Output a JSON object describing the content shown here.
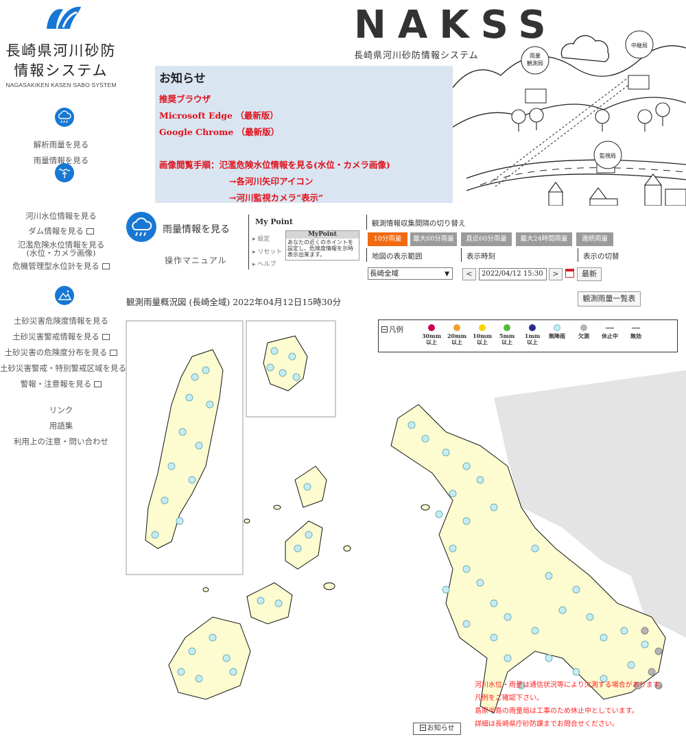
{
  "sidebar": {
    "title": "長崎県河川砂防\n情報システム",
    "subtitle": "NAGASAKIKEN KASEN SABO SYSTEM",
    "rain_links": [
      "解析雨量を見る",
      "雨量情報を見る"
    ],
    "river_links": [
      "河川水位情報を見る",
      "ダム情報を見る",
      "氾濫危険水位情報を見る\n(水位・カメラ画像)",
      "危機管理型水位計を見る"
    ],
    "sabo_links": [
      "土砂災害危険度情報を見る",
      "土砂災害警戒情報を見る",
      "土砂災害の危険度分布を見る",
      "土砂災害警戒・特別警戒区域を見る",
      "警報・注意報を見る"
    ],
    "misc_links": [
      "リンク",
      "用語集",
      "利用上の注意・問い合わせ"
    ]
  },
  "header": {
    "brand": "NAKSS",
    "brand_sub": "長崎県河川砂防情報システム",
    "illustration_labels": [
      "雨量\n観測局",
      "中継局",
      "監視局"
    ]
  },
  "notice": {
    "title": "お知らせ",
    "lines": [
      "推奨ブラウザ",
      "Microsoft Edge （最新版）",
      "Google Chrome （最新版）",
      "",
      "画像閲覧手順：氾濫危険水位情報を見る(水位・カメラ画像)",
      "→各河川矢印アイコン",
      "→河川監視カメラ”表示”"
    ]
  },
  "panel": {
    "title": "雨量情報を見る",
    "manual": "操作マニュアル",
    "mypoint": {
      "title": "My Point",
      "links": [
        "設定",
        "リセット",
        "ヘルプ"
      ],
      "box_title": "MyPoint",
      "box_text": "あなたの近くのホイントを設定し、危険度情報を示時表示出来ます。"
    },
    "interval_label": "観測情報収集間隔の切り替え",
    "rain_tabs": [
      "10分雨量",
      "最大60分雨量",
      "直近60分雨量",
      "最大24時間雨量",
      "連続雨量"
    ],
    "area_label": "地図の表示範囲",
    "time_label": "表示時刻",
    "switch_label": "表示の切替",
    "area_value": "長崎全域",
    "time_value": "2022/04/12 15:30",
    "prev": "<",
    "next": ">",
    "latest": "最新",
    "caption": "観測雨量概況図 (長崎全域) 2022年04月12日15時30分",
    "list_button": "観測雨量一覧表"
  },
  "legend": {
    "title": "凡例",
    "items": [
      {
        "label": "30mm\n以上",
        "color": "#c8005a"
      },
      {
        "label": "20mm\n以上",
        "color": "#f0a030"
      },
      {
        "label": "10mm\n以上",
        "color": "#f5d800"
      },
      {
        "label": "5mm\n以上",
        "color": "#55b83a"
      },
      {
        "label": "1mm\n以上",
        "color": "#2a2a8c"
      },
      {
        "label": "無降雨",
        "color": "#c6ecf2"
      },
      {
        "label": "欠測",
        "color": "#b4b4b4"
      },
      {
        "label": "休止中",
        "color": ""
      },
      {
        "label": "無効",
        "color": ""
      }
    ]
  },
  "map_notes": [
    "河川水位・雨量は通信状況等により欠測する場合があります。",
    "凡例をご確認下さい。",
    "島原半島の雨量局は工事のため休止中としています。",
    "詳細は長崎県庁砂防課までお問合せください。"
  ],
  "notice_toggle": "お知らせ"
}
